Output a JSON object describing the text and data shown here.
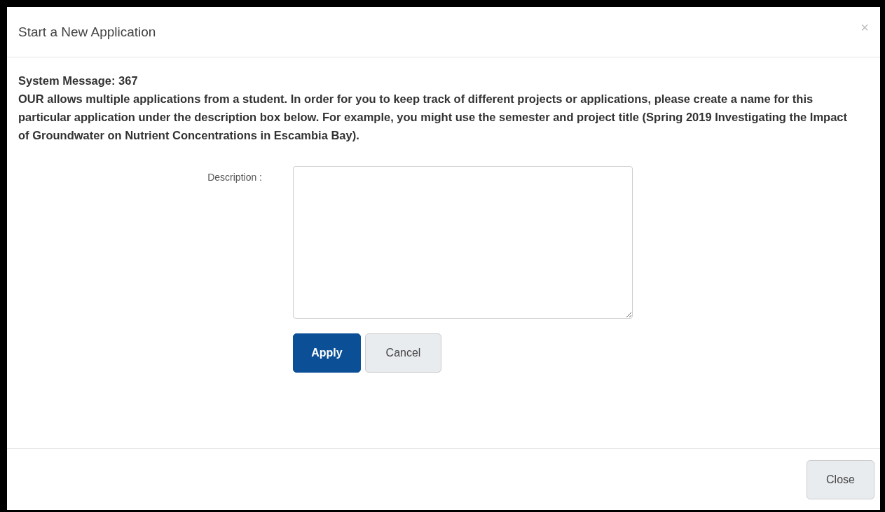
{
  "dialog": {
    "title": "Start a New Application",
    "close_icon": "×"
  },
  "message": {
    "heading": "System Message: 367",
    "text": "OUR allows multiple applications from a student. In order for you to keep track of different projects or applications, please create a name for this particular application under the description box below. For example, you might use the semester and project title (Spring 2019 Investigating the Impact of Groundwater on Nutrient Concentrations in Escambia Bay)."
  },
  "form": {
    "label": "Description :",
    "buttons": [
      {
        "label": "Apply",
        "kind": "primary"
      },
      {
        "label": "Cancel",
        "kind": "secondary"
      }
    ]
  },
  "footer": {
    "buttons": [
      {
        "label": "Close",
        "kind": "secondary"
      }
    ]
  }
}
